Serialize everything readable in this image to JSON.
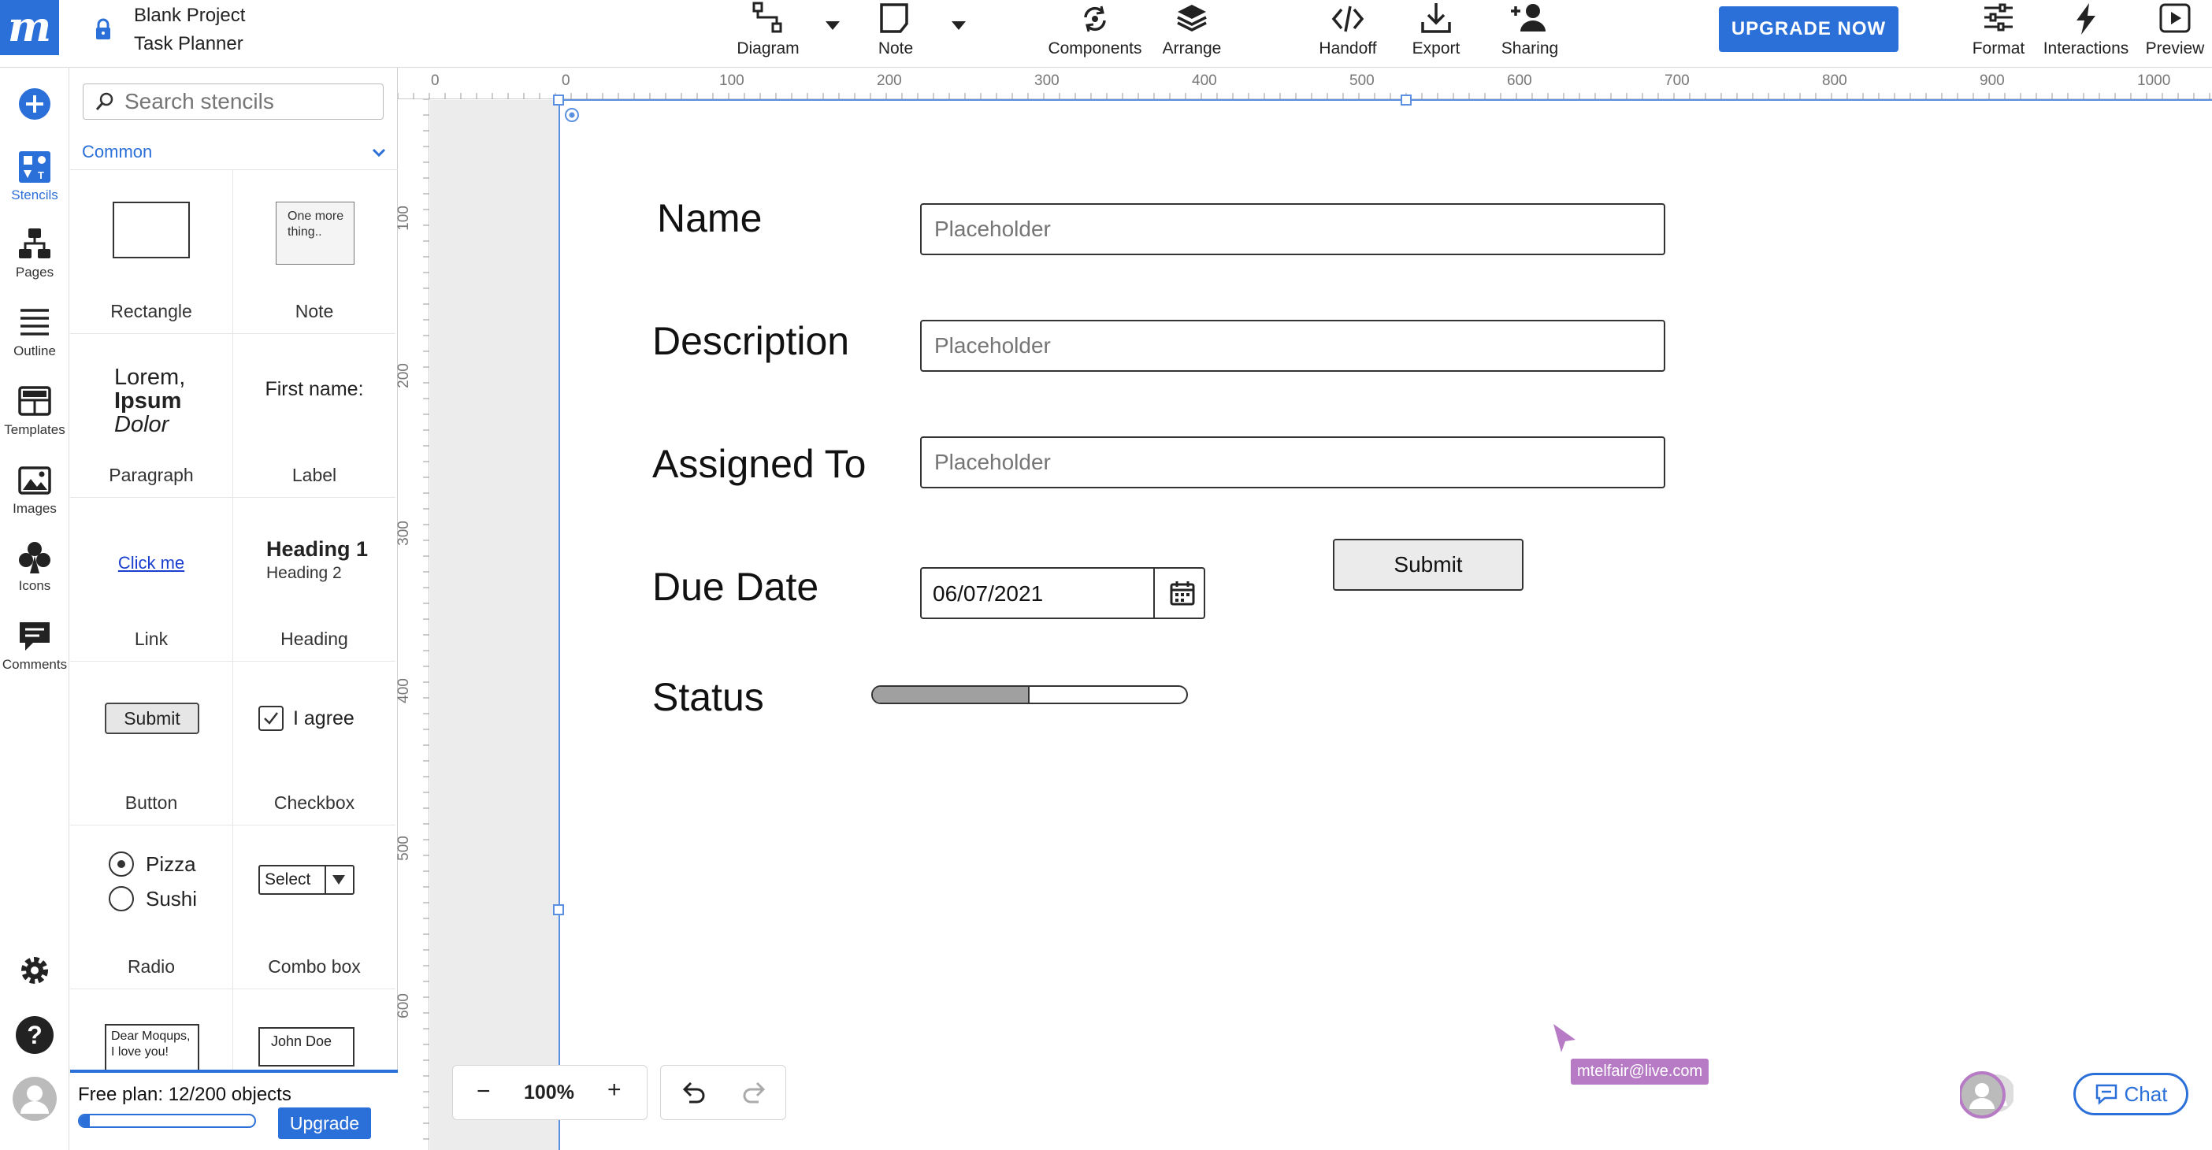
{
  "app": {
    "logo_letter": "m"
  },
  "project": {
    "name": "Blank Project",
    "page": "Task Planner"
  },
  "toolbar": {
    "diagram": "Diagram",
    "note": "Note",
    "components": "Components",
    "arrange": "Arrange",
    "handoff": "Handoff",
    "export": "Export",
    "sharing": "Sharing",
    "upgrade_now": "UPGRADE NOW",
    "format": "Format",
    "interactions": "Interactions",
    "preview": "Preview"
  },
  "rail": {
    "stencils": "Stencils",
    "pages": "Pages",
    "outline": "Outline",
    "templates": "Templates",
    "images": "Images",
    "icons": "Icons",
    "comments": "Comments"
  },
  "stencil_panel": {
    "search_placeholder": "Search stencils",
    "category": "Common",
    "items": {
      "rectangle": "Rectangle",
      "note": "Note",
      "note_preview": "One more thing..",
      "paragraph": "Paragraph",
      "paragraph_preview": [
        "Lorem,",
        "Ipsum",
        "Dolor"
      ],
      "label": "Label",
      "label_preview": "First name:",
      "link": "Link",
      "link_preview": "Click me",
      "heading": "Heading",
      "heading_preview_1": "Heading 1",
      "heading_preview_2": "Heading 2",
      "button": "Button",
      "button_preview": "Submit",
      "checkbox": "Checkbox",
      "checkbox_preview": "I agree",
      "radio": "Radio",
      "radio_preview": [
        "Pizza",
        "Sushi"
      ],
      "combo": "Combo box",
      "combo_preview": "Select",
      "partial_1": "Dear Moqups, I love you!",
      "partial_2": "John Doe"
    },
    "free_plan": "Free plan: 12/200 objects",
    "free_plan_fraction": 0.06,
    "upgrade": "Upgrade"
  },
  "ruler": {
    "top": [
      "0",
      "0",
      "100",
      "200",
      "300",
      "400",
      "500",
      "600",
      "700",
      "800",
      "900",
      "1000"
    ],
    "left": [
      "100",
      "200",
      "300",
      "400",
      "500",
      "600"
    ]
  },
  "form": {
    "name_label": "Name",
    "description_label": "Description",
    "assigned_label": "Assigned To",
    "due_date_label": "Due Date",
    "status_label": "Status",
    "placeholder": "Placeholder",
    "due_date_value": "06/07/2021",
    "submit": "Submit",
    "status_progress": 0.5
  },
  "bottom": {
    "zoom": "100%",
    "zoom_out": "−",
    "zoom_in": "+",
    "cursor_user": "mtelfair@live.com",
    "chat": "Chat"
  },
  "colors": {
    "accent": "#2b6fd8",
    "cursor": "#b67bc4"
  }
}
